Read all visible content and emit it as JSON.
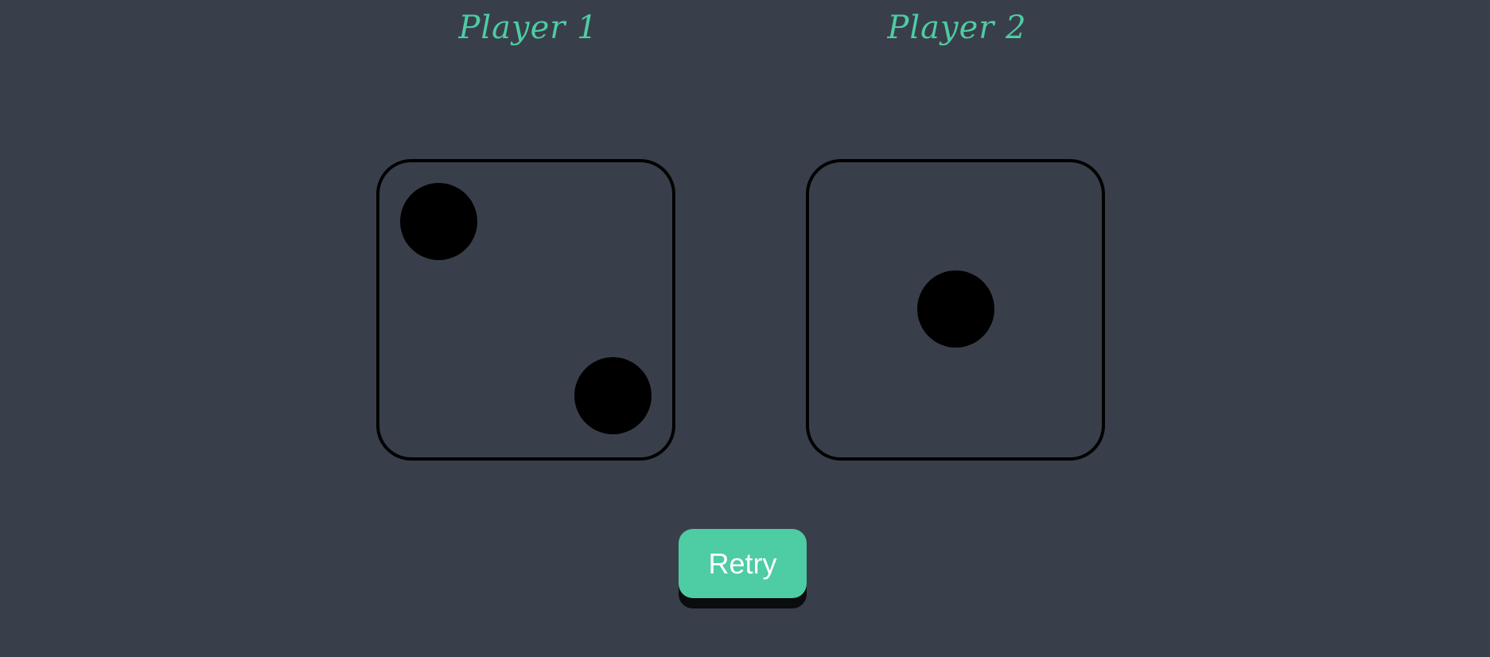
{
  "players": [
    {
      "label": "Player 1",
      "die_value": 2
    },
    {
      "label": "Player 2",
      "die_value": 1
    }
  ],
  "retry_button": {
    "label": "Retry"
  },
  "colors": {
    "background": "#393f4a",
    "accent": "#4ecca3",
    "pip": "#000000",
    "button_text": "#ffffff"
  }
}
